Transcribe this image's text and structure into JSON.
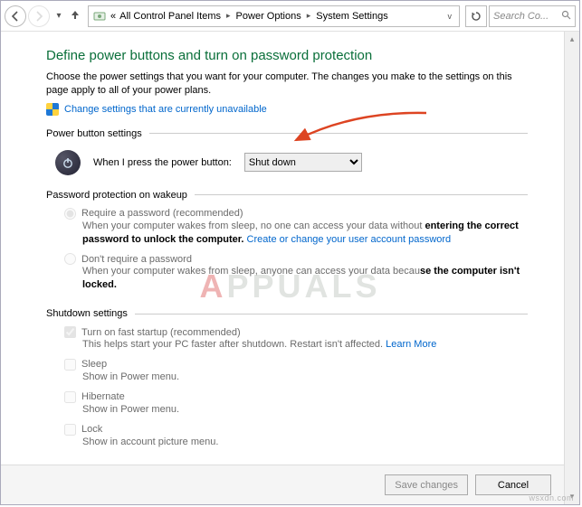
{
  "nav": {
    "breadcrumbs_prefix": "«",
    "crumbs": [
      "All Control Panel Items",
      "Power Options",
      "System Settings"
    ],
    "search_placeholder": "Search Co..."
  },
  "page": {
    "title": "Define power buttons and turn on password protection",
    "intro": "Choose the power settings that you want for your computer. The changes you make to the settings on this page apply to all of your power plans.",
    "change_link": "Change settings that are currently unavailable"
  },
  "sections": {
    "power_button": {
      "heading": "Power button settings",
      "label": "When I press the power button:",
      "selected": "Shut down"
    },
    "password": {
      "heading": "Password protection on wakeup",
      "options": [
        {
          "label": "Require a password (recommended)",
          "desc_pre": "When your computer wakes from sleep, no one can access your data without ",
          "desc_bold": "entering the correct password to unlock the computer.",
          "link": "Create or change your user account password",
          "checked": true
        },
        {
          "label": "Don't require a password",
          "desc_pre": "When your computer wakes from sleep, anyone can access your data becau",
          "desc_bold": "se the computer isn't locked.",
          "checked": false
        }
      ]
    },
    "shutdown": {
      "heading": "Shutdown settings",
      "options": [
        {
          "label": "Turn on fast startup (recommended)",
          "checked": true,
          "desc": "This helps start your PC faster after shutdown. Restart isn't affected. ",
          "link": "Learn More"
        },
        {
          "label": "Sleep",
          "checked": false,
          "desc": "Show in Power menu."
        },
        {
          "label": "Hibernate",
          "checked": false,
          "desc": "Show in Power menu."
        },
        {
          "label": "Lock",
          "checked": false,
          "desc": "Show in account picture menu."
        }
      ]
    }
  },
  "buttons": {
    "save": "Save changes",
    "cancel": "Cancel"
  },
  "watermark": {
    "a": "A",
    "rest": "PPUALS"
  },
  "attribution": "wsxdn.com"
}
